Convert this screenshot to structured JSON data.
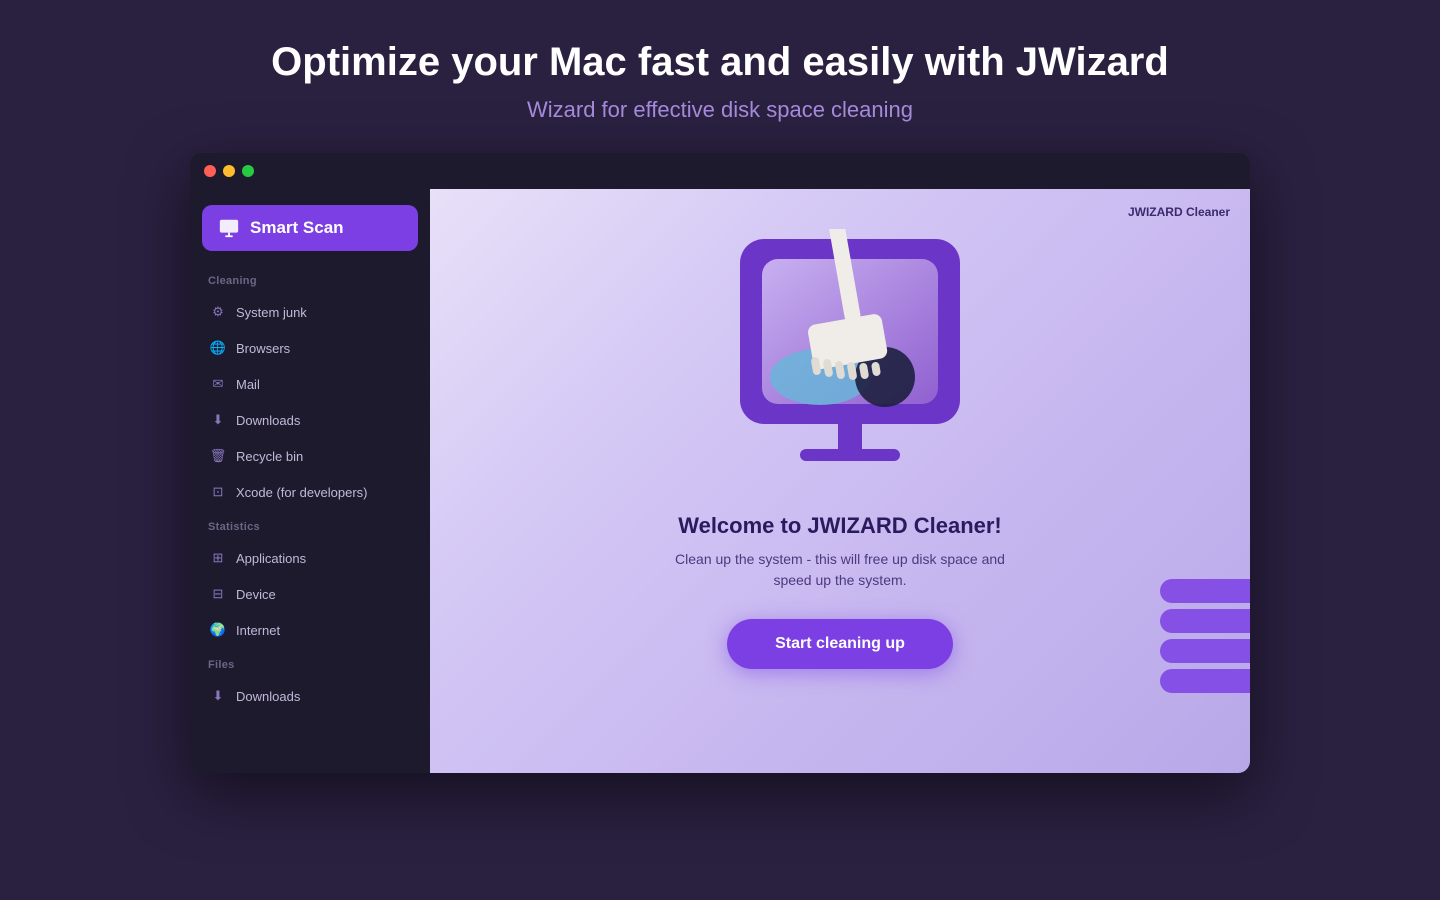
{
  "header": {
    "title": "Optimize your Mac fast and easily with JWizard",
    "subtitle": "Wizard for effective disk space cleaning"
  },
  "titlebar": {
    "traffic_lights": [
      "red",
      "yellow",
      "green"
    ]
  },
  "sidebar": {
    "smart_scan_label": "Smart Scan",
    "sections": [
      {
        "label": "Cleaning",
        "items": [
          {
            "id": "system-junk",
            "label": "System junk",
            "icon": "⚙"
          },
          {
            "id": "browsers",
            "label": "Browsers",
            "icon": "🌐"
          },
          {
            "id": "mail",
            "label": "Mail",
            "icon": "✉"
          },
          {
            "id": "downloads",
            "label": "Downloads",
            "icon": "⬇"
          },
          {
            "id": "recycle-bin",
            "label": "Recycle bin",
            "icon": "🗑"
          },
          {
            "id": "xcode",
            "label": "Xcode (for developers)",
            "icon": "⊡"
          }
        ]
      },
      {
        "label": "Statistics",
        "items": [
          {
            "id": "applications",
            "label": "Applications",
            "icon": "⊞"
          },
          {
            "id": "device",
            "label": "Device",
            "icon": "⊟"
          },
          {
            "id": "internet",
            "label": "Internet",
            "icon": "🌍"
          }
        ]
      },
      {
        "label": "Files",
        "items": [
          {
            "id": "files-downloads",
            "label": "Downloads",
            "icon": "⬇"
          }
        ]
      }
    ]
  },
  "content": {
    "app_label": "JWIZARD Cleaner",
    "welcome_title": "Welcome to JWIZARD Cleaner!",
    "welcome_desc": "Clean up the system - this will free up disk space and\nspeed up the system.",
    "start_button_label": "Start cleaning up"
  }
}
